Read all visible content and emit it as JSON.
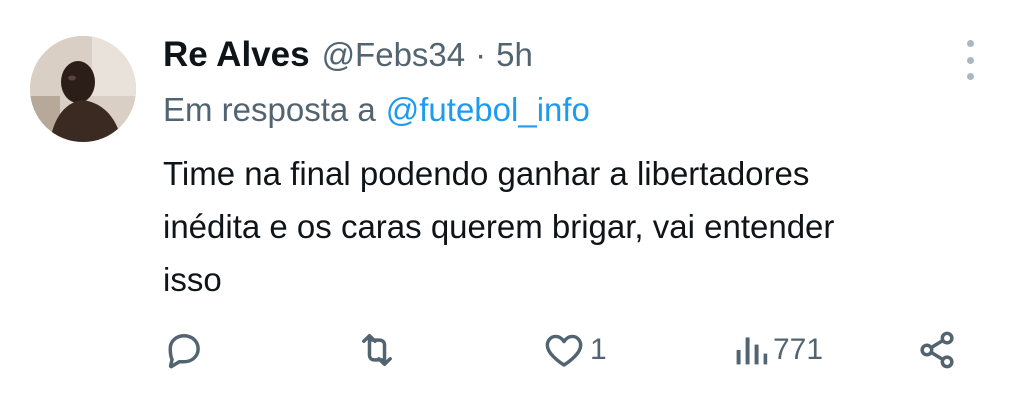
{
  "tweet": {
    "author_name": "Re Alves",
    "author_handle": "@Febs34",
    "separator": "·",
    "time": "5h",
    "reply_prefix": "Em resposta a",
    "reply_mention": "@futebol_info",
    "text": "Time na final podendo ganhar a libertadores\ninédita e os caras querem brigar, vai entender\nisso"
  },
  "actions": {
    "reply_icon": "reply-bubble-icon",
    "retweet_icon": "retweet-icon",
    "like_icon": "heart-icon",
    "like_count": "1",
    "views_icon": "views-bar-chart-icon",
    "views_count": "771",
    "share_icon": "share-icon"
  },
  "colors": {
    "text_primary": "#0f1419",
    "text_secondary": "#536471",
    "link": "#1d9bf0",
    "background": "#ffffff"
  }
}
